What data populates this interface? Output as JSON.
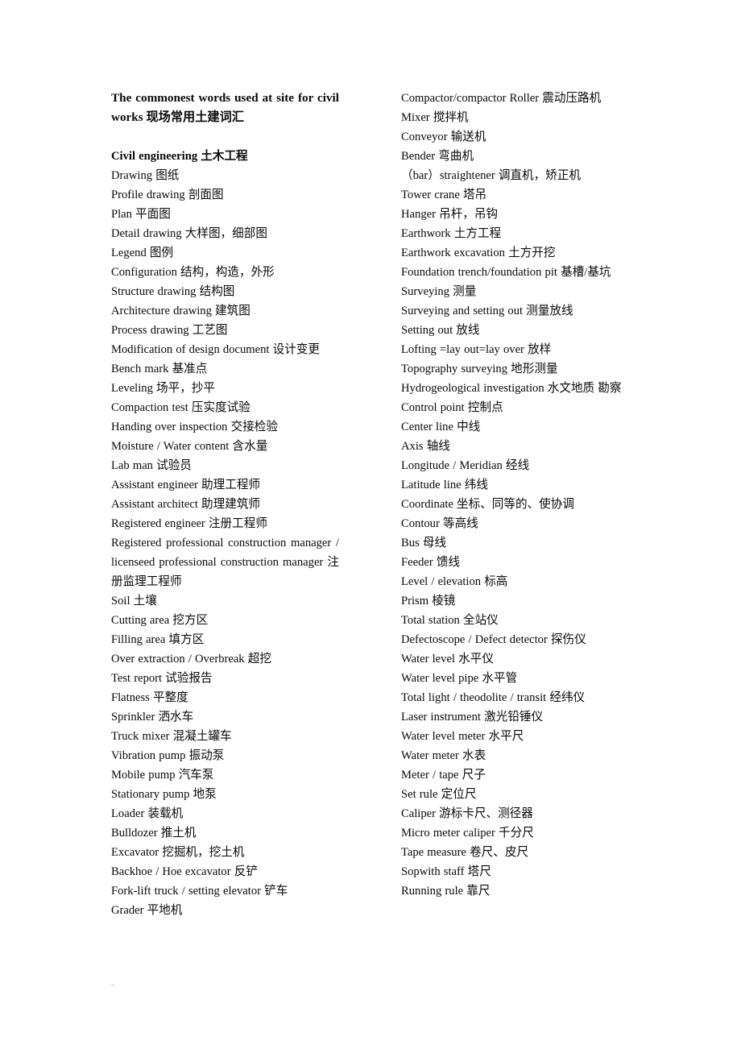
{
  "page": {
    "background_color": "#ffffff",
    "text_color": "#0a0a0a"
  },
  "document": {
    "title": "The commonest words used at site for civil works 现场常用土建词汇",
    "section_heading": "Civil engineering  土木工程"
  },
  "left_column": {
    "entries": [
      "Drawing  图纸",
      "Profile drawing  剖面图",
      "Plan  平面图",
      "Detail drawing 大样图，细部图",
      "Legend  图例",
      "Configuration  结构，构造，外形",
      "Structure drawing  结构图",
      "Architecture drawing  建筑图",
      "Process drawing  工艺图",
      "Modification of design document  设计变更",
      "Bench mark  基准点",
      "Leveling  场平，抄平",
      "Compaction test  压实度试验",
      "Handing over inspection  交接检验",
      "Moisture / Water content  含水量",
      "Lab man  试验员",
      "Assistant engineer  助理工程师",
      "Assistant architect  助理建筑师",
      "Registered engineer  注册工程师",
      "Registered professional construction manager / licenseed professional construction manager 注册监理工程师",
      "Soil  土壤",
      "Cutting area 挖方区",
      "Filling area 填方区",
      "Over extraction / Overbreak  超挖",
      "Test report  试验报告",
      "Flatness  平整度",
      "Sprinkler  洒水车",
      "Truck mixer  混凝土罐车",
      "Vibration pump  振动泵",
      "Mobile pump  汽车泵",
      "Stationary pump  地泵",
      "Loader  装载机",
      "Bulldozer  推土机",
      "Excavator  挖掘机，挖土机",
      "Backhoe / Hoe excavator  反铲",
      "Fork-lift truck / setting elevator  铲车",
      "Grader  平地机"
    ],
    "justified_indices": [
      19
    ]
  },
  "right_column": {
    "entries": [
      "Compactor/compactor Roller  震动压路机",
      "Mixer  搅拌机",
      "Conveyor  输送机",
      "Bender  弯曲机",
      "（bar）straightener  调直机，矫正机",
      "Tower crane  塔吊",
      "Hanger  吊杆，吊钩",
      "Earthwork  土方工程",
      "Earthwork excavation  土方开挖",
      "Foundation trench/foundation pit  基槽/基坑",
      "Surveying  测量",
      "Surveying and setting out  测量放线",
      "Setting out  放线",
      "Lofting =lay out=lay over 放样",
      "Topography surveying  地形测量",
      "Hydrogeological investigation  水文地质 勘察",
      "Control point  控制点",
      "Center line  中线",
      "Axis  轴线",
      "Longitude / Meridian  经线",
      "Latitude line 纬线",
      "Coordinate 坐标、同等的、使协调",
      "Contour  等高线",
      "Bus  母线",
      "Feeder  馈线",
      "Level / elevation  标高",
      "Prism  棱镜",
      "Total station  全站仪",
      "Defectoscope   / Defect detector  探伤仪",
      "Water level  水平仪",
      "Water level pipe  水平管",
      "Total light / theodolite / transit 经纬仪",
      "Laser instrument  激光铅锤仪",
      "Water level meter  水平尺",
      "Water meter  水表",
      "Meter / tape  尺子",
      "Set rule  定位尺",
      "Caliper  游标卡尺、测径器",
      "Micro meter caliper  千分尺",
      "Tape measure  卷尺、皮尺",
      "Sopwith staff  塔尺",
      "Running rule  靠尺"
    ],
    "justified_indices": [
      9,
      15
    ]
  }
}
